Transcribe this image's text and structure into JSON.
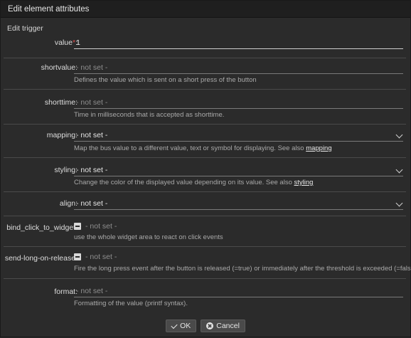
{
  "dialog": {
    "title": "Edit element attributes"
  },
  "section_title": "Edit trigger",
  "fields": {
    "value": {
      "label": "value",
      "required_mark": "*",
      "suffix": ":",
      "value": "1"
    },
    "shortvalue": {
      "label": "shortvalue:",
      "placeholder": "- not set -",
      "desc": "Defines the value which is sent on a short press of the button"
    },
    "shorttime": {
      "label": "shorttime:",
      "placeholder": "- not set -",
      "desc": "Time in milliseconds that is accepted as shorttime."
    },
    "mapping": {
      "label": "mapping:",
      "selected": "- not set -",
      "desc": "Map the bus value to a different value, text or symbol for displaying. See also ",
      "link": "mapping"
    },
    "styling": {
      "label": "styling:",
      "selected": "- not set -",
      "desc": "Change the color of the displayed value depending on its value. See also ",
      "link": "styling"
    },
    "align": {
      "label": "align:",
      "selected": "- not set -"
    },
    "bind_click_to_widget": {
      "label": "bind_click_to_widget:",
      "state": "- not set -",
      "desc": "use the whole widget area to react on click events"
    },
    "send_long_on_release": {
      "label": "send-long-on-release:",
      "state": "- not set -",
      "desc": "Fire the long press event after the button is released (=true) or immediately after the threshold is exceeded (=false)."
    },
    "format": {
      "label": "format:",
      "placeholder": "- not set -",
      "desc": "Formatting of the value (printf syntax)."
    }
  },
  "buttons": {
    "ok": "OK",
    "cancel": "Cancel"
  }
}
